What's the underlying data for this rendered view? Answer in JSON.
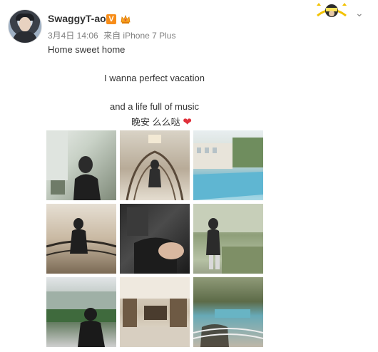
{
  "post": {
    "username": "SwaggyT-ao",
    "verified_badge": "V",
    "date": "3月4日 14:06",
    "source_prefix": "来自",
    "source_device": "iPhone 7 Plus",
    "text_line1": "Home sweet home",
    "text_line2": "I wanna perfect vacation",
    "text_line3": "and a life full of music",
    "text_line4": "晚安 么么哒",
    "heart": "❤"
  },
  "icons": {
    "avatar": "profile-avatar",
    "verified": "verified-v-icon",
    "member": "crown-icon",
    "card_decoration": "card-decoration-icon",
    "more": "chevron-down-icon"
  },
  "colors": {
    "badge": "#f78d19",
    "heart": "#e0303a",
    "meta_text": "#808080",
    "body_text": "#333333"
  },
  "photos": [
    {
      "label": "photo-1"
    },
    {
      "label": "photo-2"
    },
    {
      "label": "photo-3"
    },
    {
      "label": "photo-4"
    },
    {
      "label": "photo-5"
    },
    {
      "label": "photo-6"
    },
    {
      "label": "photo-7"
    },
    {
      "label": "photo-8"
    },
    {
      "label": "photo-9"
    }
  ]
}
